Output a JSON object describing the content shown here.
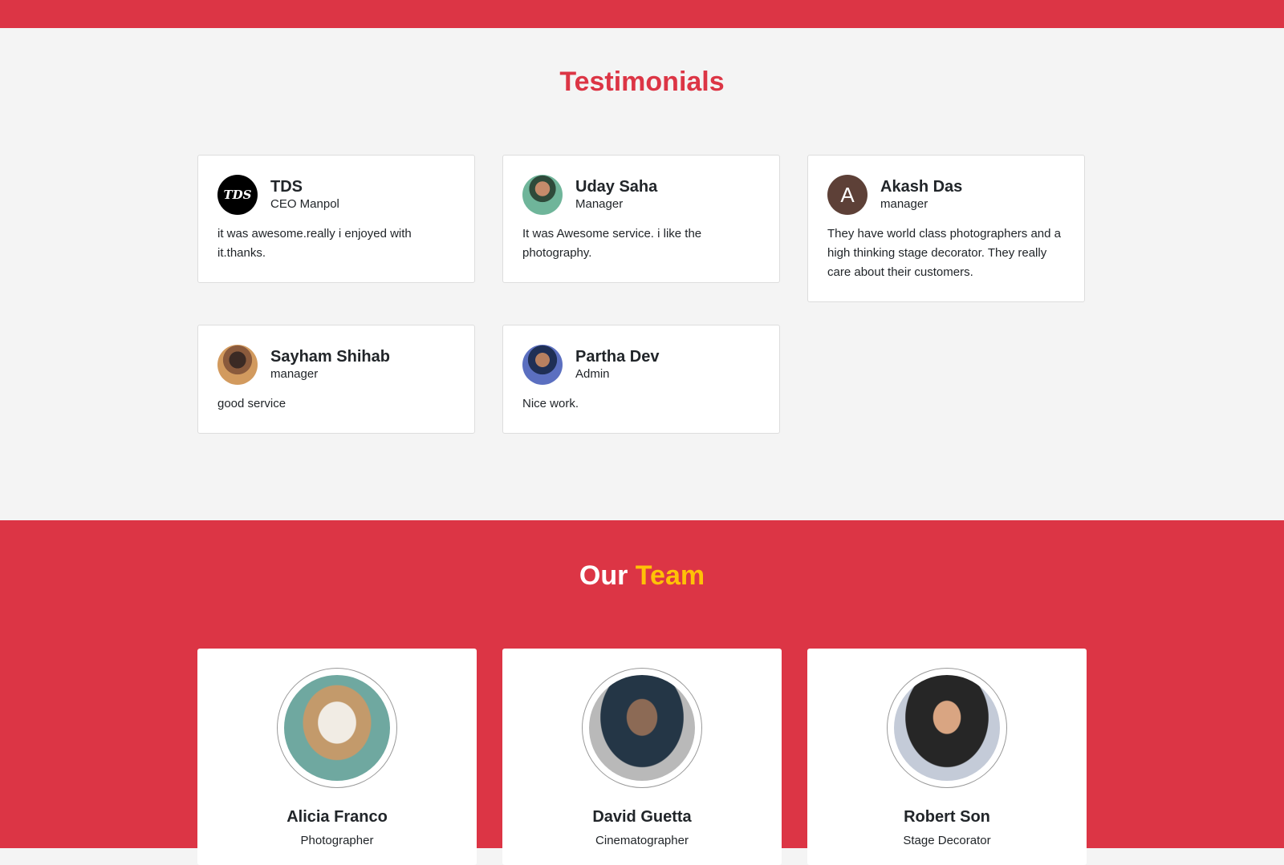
{
  "testimonials": {
    "title": "Testimonials",
    "items": [
      {
        "name": "TDS",
        "role": "CEO Manpol",
        "text": "it was awesome.really i enjoyed with it.thanks.",
        "avatar": "TDS"
      },
      {
        "name": "Uday Saha",
        "role": "Manager",
        "text": "It was Awesome service. i like the photography.",
        "avatar": ""
      },
      {
        "name": "Akash Das",
        "role": "manager",
        "text": "They have world class photographers and a high thinking stage decorator. They really care about their customers.",
        "avatar": "A"
      },
      {
        "name": "Sayham Shihab",
        "role": "manager",
        "text": "good service",
        "avatar": ""
      },
      {
        "name": "Partha Dev",
        "role": "Admin",
        "text": "Nice work.",
        "avatar": ""
      }
    ]
  },
  "team": {
    "title_prefix": "Our",
    "title_accent": "Team",
    "members": [
      {
        "name": "Alicia Franco",
        "role": "Photographer"
      },
      {
        "name": "David Guetta",
        "role": "Cinematographer"
      },
      {
        "name": "Robert Son",
        "role": "Stage Decorator"
      }
    ]
  },
  "colors": {
    "accent": "#dc3545",
    "highlight": "#ffc107",
    "background": "#f4f4f4"
  }
}
